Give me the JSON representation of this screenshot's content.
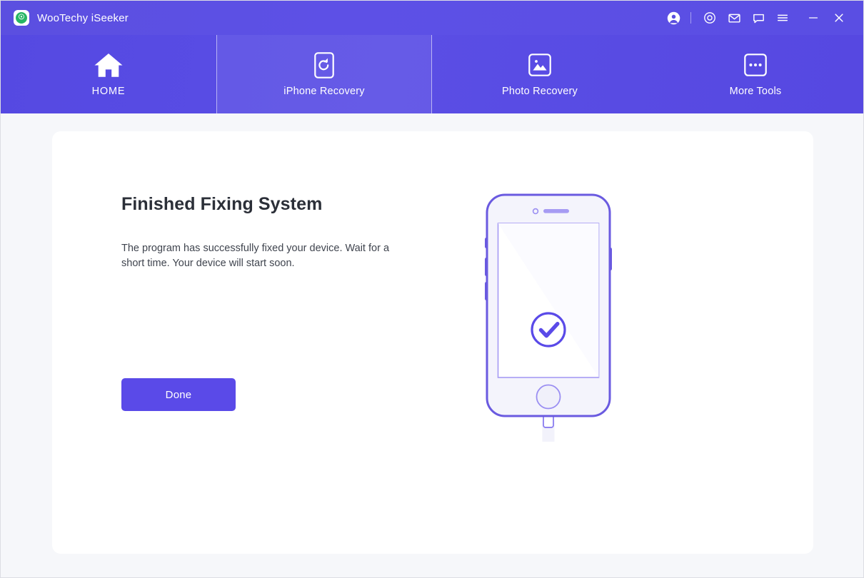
{
  "window": {
    "app_title": "WooTechy iSeeker",
    "logo_icon": "app-logo-icon",
    "accent_color": "#5a4ae8",
    "titlebar_color": "#5b4fe0",
    "titlebar_actions": [
      {
        "name": "account-avatar-icon",
        "label": "Account"
      },
      {
        "name": "target-icon",
        "label": "Registration"
      },
      {
        "name": "envelope-icon",
        "label": "Feedback"
      },
      {
        "name": "chat-bubble-icon",
        "label": "Support"
      },
      {
        "name": "hamburger-menu-icon",
        "label": "Menu"
      },
      {
        "name": "minimize-icon",
        "label": "Minimize"
      },
      {
        "name": "close-icon",
        "label": "Close"
      }
    ]
  },
  "nav": {
    "tabs": [
      {
        "label": "HOME",
        "icon": "home-icon",
        "active": false
      },
      {
        "label": "iPhone Recovery",
        "icon": "phone-refresh-icon",
        "active": true
      },
      {
        "label": "Photo Recovery",
        "icon": "image-icon",
        "active": false
      },
      {
        "label": "More Tools",
        "icon": "more-dots-icon",
        "active": false
      }
    ]
  },
  "main": {
    "heading": "Finished Fixing System",
    "description": "The program has successfully fixed your device. Wait for a short time. Your device will start soon.",
    "done_label": "Done",
    "illustration": {
      "name": "iphone-success-illustration",
      "status_icon": "check-circle-icon",
      "outline_color": "#6a5ae0"
    }
  }
}
